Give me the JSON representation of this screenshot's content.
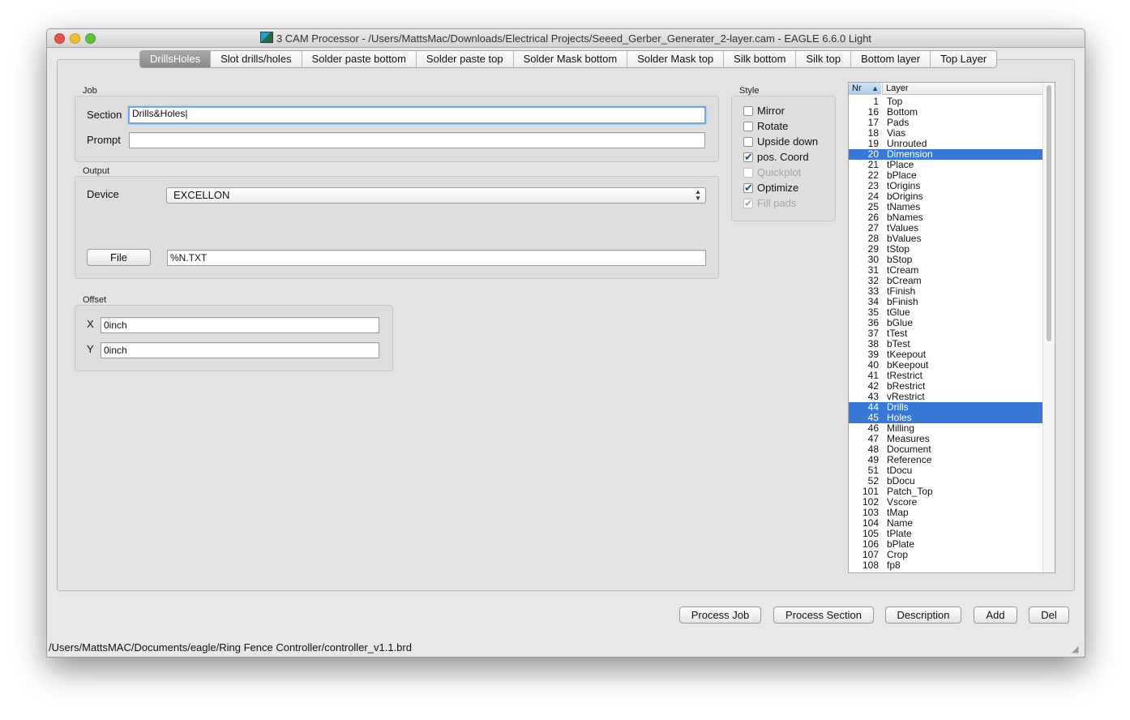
{
  "window": {
    "title": "3 CAM Processor - /Users/MattsMac/Downloads/Electrical Projects/Seeed_Gerber_Generater_2-layer.cam - EAGLE 6.6.0 Light"
  },
  "tabs": [
    {
      "label": "DrillsHoles",
      "active": true
    },
    {
      "label": "Slot drills/holes"
    },
    {
      "label": "Solder paste bottom"
    },
    {
      "label": "Solder paste top"
    },
    {
      "label": "Solder Mask bottom"
    },
    {
      "label": "Solder Mask top"
    },
    {
      "label": "Silk bottom"
    },
    {
      "label": "Silk top"
    },
    {
      "label": "Bottom layer"
    },
    {
      "label": "Top Layer"
    }
  ],
  "job": {
    "title": "Job",
    "section_label": "Section",
    "section_value": "Drills&Holes|",
    "prompt_label": "Prompt",
    "prompt_value": ""
  },
  "output": {
    "title": "Output",
    "device_label": "Device",
    "device_value": "EXCELLON",
    "file_button": "File",
    "file_value": "%N.TXT"
  },
  "offset": {
    "title": "Offset",
    "x_label": "X",
    "x_value": "0inch",
    "y_label": "Y",
    "y_value": "0inch"
  },
  "style": {
    "title": "Style",
    "options": [
      {
        "label": "Mirror",
        "checked": false,
        "enabled": true
      },
      {
        "label": "Rotate",
        "checked": false,
        "enabled": true
      },
      {
        "label": "Upside down",
        "checked": false,
        "enabled": true
      },
      {
        "label": "pos. Coord",
        "checked": true,
        "enabled": true
      },
      {
        "label": "Quickplot",
        "checked": false,
        "enabled": false
      },
      {
        "label": "Optimize",
        "checked": true,
        "enabled": true
      },
      {
        "label": "Fill pads",
        "checked": true,
        "enabled": false
      }
    ]
  },
  "layers": {
    "col_nr": "Nr",
    "col_layer": "Layer",
    "rows": [
      {
        "nr": "1",
        "name": "Top"
      },
      {
        "nr": "16",
        "name": "Bottom"
      },
      {
        "nr": "17",
        "name": "Pads"
      },
      {
        "nr": "18",
        "name": "Vias"
      },
      {
        "nr": "19",
        "name": "Unrouted"
      },
      {
        "nr": "20",
        "name": "Dimension",
        "selected": true
      },
      {
        "nr": "21",
        "name": "tPlace"
      },
      {
        "nr": "22",
        "name": "bPlace"
      },
      {
        "nr": "23",
        "name": "tOrigins"
      },
      {
        "nr": "24",
        "name": "bOrigins"
      },
      {
        "nr": "25",
        "name": "tNames"
      },
      {
        "nr": "26",
        "name": "bNames"
      },
      {
        "nr": "27",
        "name": "tValues"
      },
      {
        "nr": "28",
        "name": "bValues"
      },
      {
        "nr": "29",
        "name": "tStop"
      },
      {
        "nr": "30",
        "name": "bStop"
      },
      {
        "nr": "31",
        "name": "tCream"
      },
      {
        "nr": "32",
        "name": "bCream"
      },
      {
        "nr": "33",
        "name": "tFinish"
      },
      {
        "nr": "34",
        "name": "bFinish"
      },
      {
        "nr": "35",
        "name": "tGlue"
      },
      {
        "nr": "36",
        "name": "bGlue"
      },
      {
        "nr": "37",
        "name": "tTest"
      },
      {
        "nr": "38",
        "name": "bTest"
      },
      {
        "nr": "39",
        "name": "tKeepout"
      },
      {
        "nr": "40",
        "name": "bKeepout"
      },
      {
        "nr": "41",
        "name": "tRestrict"
      },
      {
        "nr": "42",
        "name": "bRestrict"
      },
      {
        "nr": "43",
        "name": "vRestrict"
      },
      {
        "nr": "44",
        "name": "Drills",
        "selected": true
      },
      {
        "nr": "45",
        "name": "Holes",
        "selected": true
      },
      {
        "nr": "46",
        "name": "Milling"
      },
      {
        "nr": "47",
        "name": "Measures"
      },
      {
        "nr": "48",
        "name": "Document"
      },
      {
        "nr": "49",
        "name": "Reference"
      },
      {
        "nr": "51",
        "name": "tDocu"
      },
      {
        "nr": "52",
        "name": "bDocu"
      },
      {
        "nr": "101",
        "name": "Patch_Top"
      },
      {
        "nr": "102",
        "name": "Vscore"
      },
      {
        "nr": "103",
        "name": "tMap"
      },
      {
        "nr": "104",
        "name": "Name"
      },
      {
        "nr": "105",
        "name": "tPlate"
      },
      {
        "nr": "106",
        "name": "bPlate"
      },
      {
        "nr": "107",
        "name": "Crop"
      },
      {
        "nr": "108",
        "name": "fp8"
      }
    ]
  },
  "buttons": {
    "process_job": "Process Job",
    "process_section": "Process Section",
    "description": "Description",
    "add": "Add",
    "del": "Del"
  },
  "status": {
    "path": "/Users/MattsMAC/Documents/eagle/Ring Fence Controller/controller_v1.1.brd"
  }
}
